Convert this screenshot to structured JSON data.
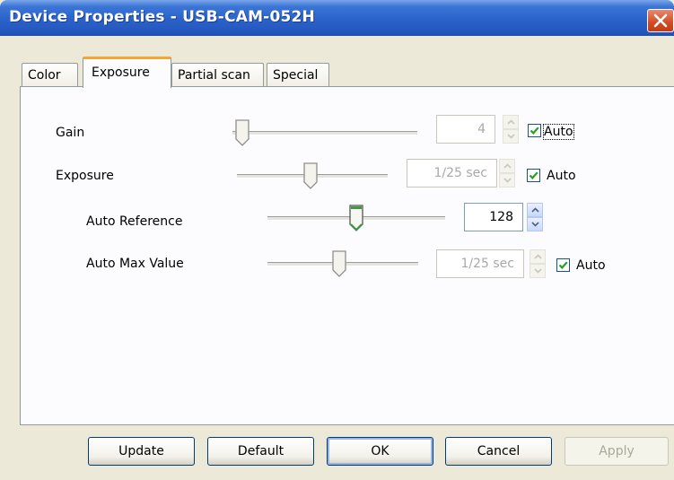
{
  "window": {
    "title": "Device Properties - USB-CAM-052H"
  },
  "tabs": [
    {
      "label": "Color",
      "active": false
    },
    {
      "label": "Exposure",
      "active": true
    },
    {
      "label": "Partial scan",
      "active": false
    },
    {
      "label": "Special",
      "active": false
    }
  ],
  "gain": {
    "label": "Gain",
    "value": "4",
    "enabled": false,
    "slider_level": 0.0,
    "auto_label": "Auto",
    "auto_checked": true
  },
  "exposure": {
    "label": "Exposure",
    "value": "1/25 sec",
    "enabled": false,
    "slider_level": 0.5,
    "auto_label": "Auto",
    "auto_checked": true
  },
  "auto_reference": {
    "label": "Auto Reference",
    "value": "128",
    "enabled": true,
    "slider_level": 0.5
  },
  "auto_max_value": {
    "label": "Auto Max Value",
    "value": "1/25 sec",
    "enabled": false,
    "slider_level": 0.5,
    "auto_label": "Auto",
    "auto_checked": true
  },
  "buttons": {
    "update": "Update",
    "default": "Default",
    "ok": "OK",
    "cancel": "Cancel",
    "apply": "Apply"
  },
  "colors": {
    "titlebar": "#2a62c9",
    "tab_highlight": "#f5a530",
    "check_mark": "#21a121",
    "active_thumb": "#3e9a3e"
  },
  "icons": [
    "close-icon",
    "spin-up-icon",
    "spin-down-icon",
    "check-icon",
    "slider-thumb-icon"
  ]
}
